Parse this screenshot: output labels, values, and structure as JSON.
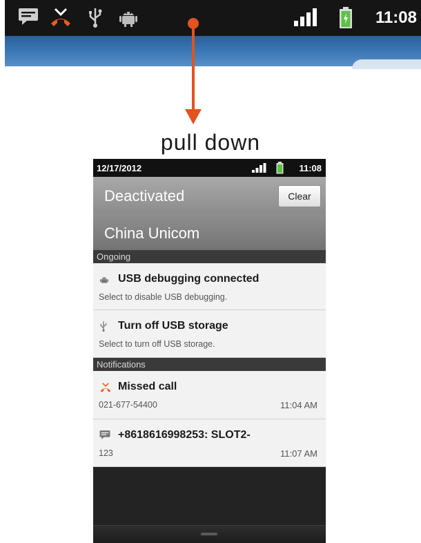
{
  "top_status_bar": {
    "icons": [
      "message-icon",
      "missed-call-icon",
      "usb-icon",
      "android-debug-icon",
      "signal-icon",
      "battery-icon"
    ],
    "time": "11:08"
  },
  "caption": "pull down",
  "colors": {
    "accent": "#e2531f",
    "status_bar": "#151515",
    "battery": "#5cc244"
  },
  "phone": {
    "status": {
      "date": "12/17/2012",
      "time": "11:08"
    },
    "header": {
      "status_label": "Deactivated",
      "clear_label": "Clear",
      "carrier": "China Unicom"
    },
    "ongoing": {
      "label": "Ongoing",
      "items": [
        {
          "icon": "android-debug-icon",
          "title": "USB debugging connected",
          "subtitle": "Select to disable USB debugging."
        },
        {
          "icon": "usb-icon",
          "title": "Turn off USB storage",
          "subtitle": "Select to turn off USB storage."
        }
      ]
    },
    "notifications": {
      "label": "Notifications",
      "items": [
        {
          "icon": "missed-call-icon",
          "title": "Missed call",
          "subtitle": "021-677-54400",
          "time": "11:04 AM"
        },
        {
          "icon": "message-icon",
          "title": "+8618616998253: SLOT2-",
          "subtitle": "123",
          "time": "11:07 AM"
        }
      ]
    }
  }
}
